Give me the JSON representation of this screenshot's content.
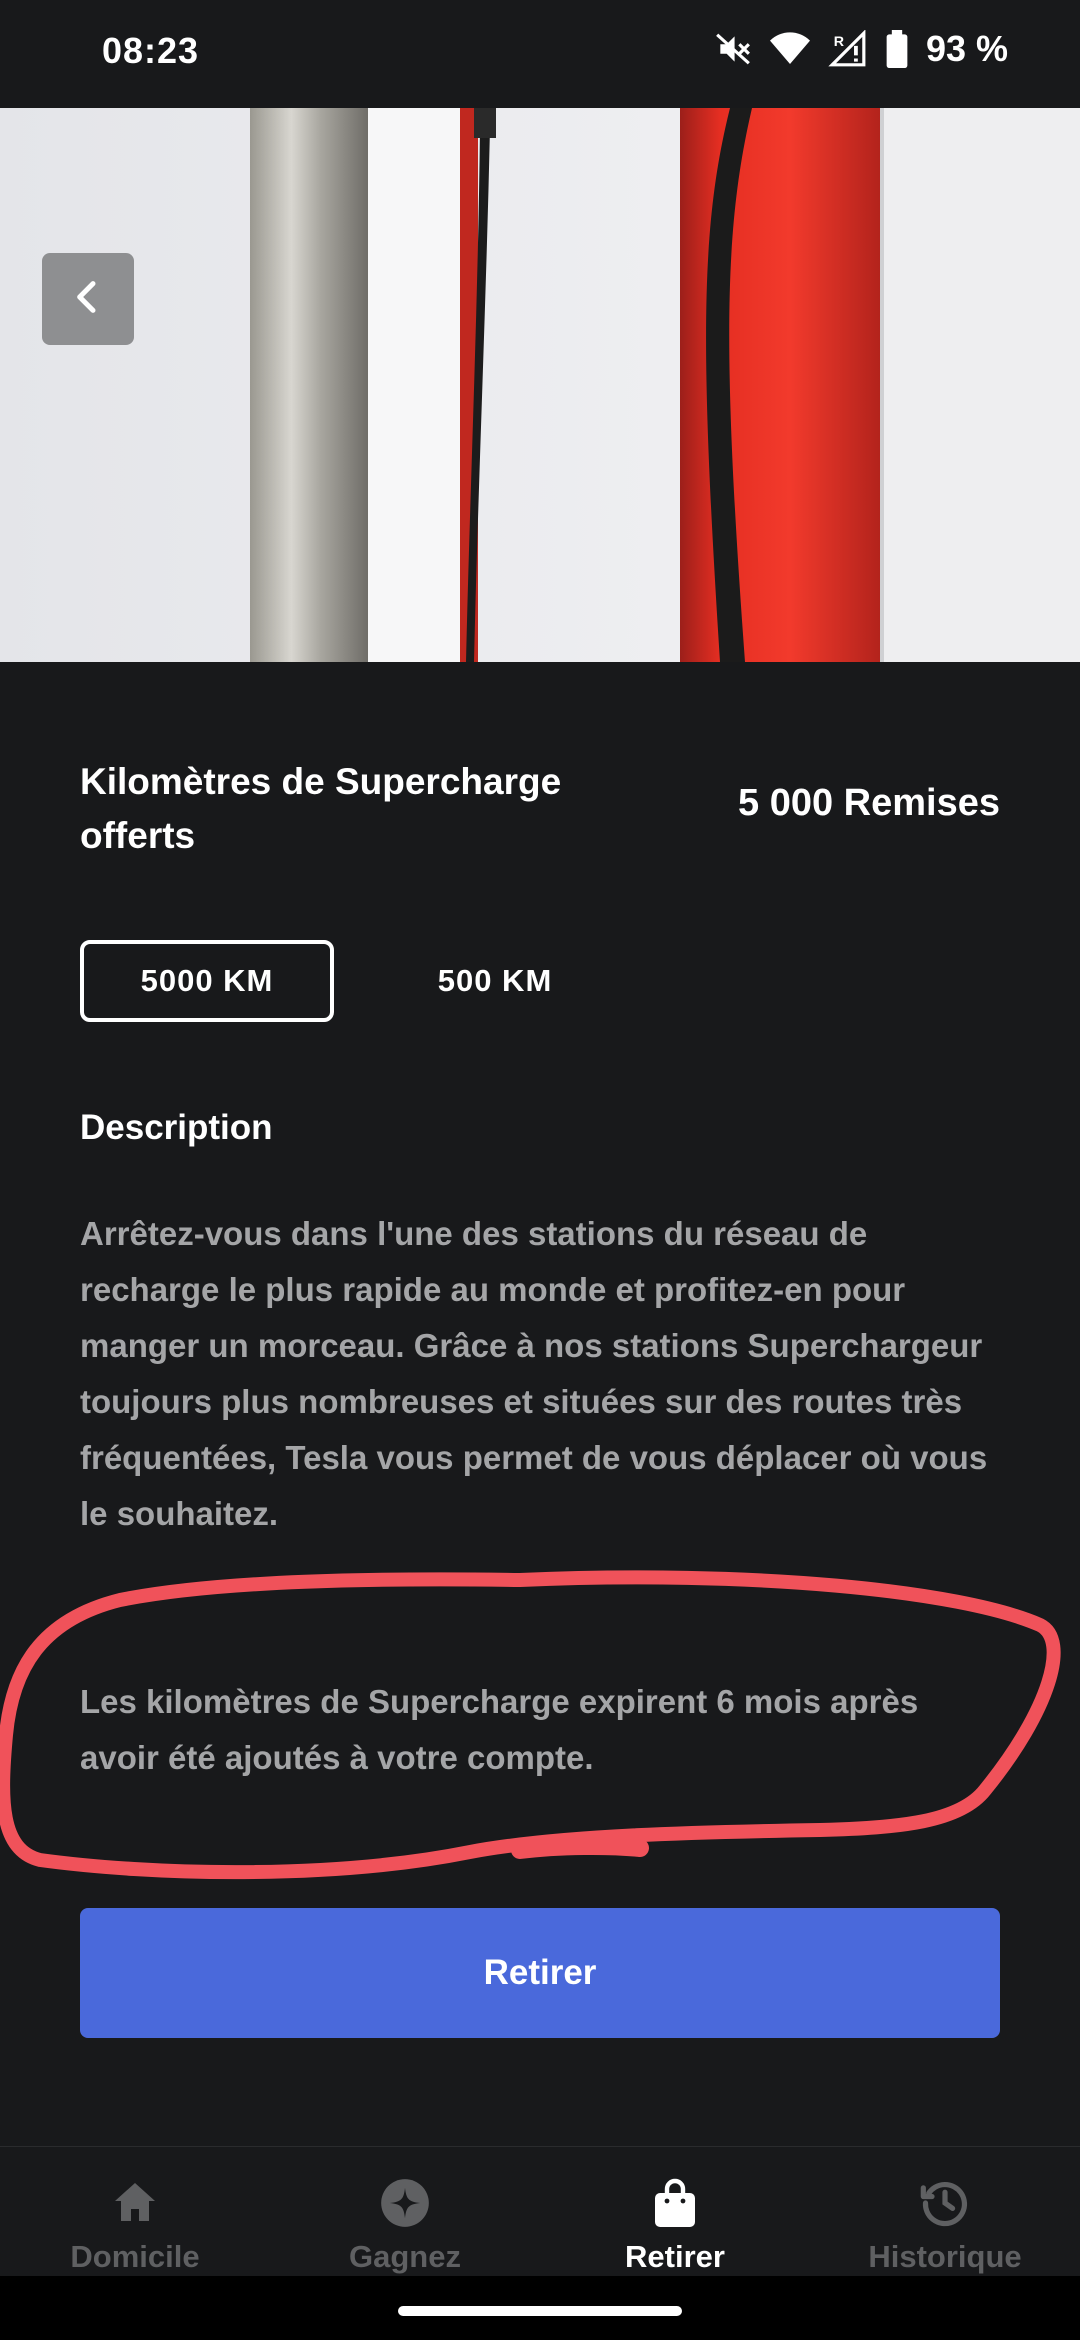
{
  "status_bar": {
    "time": "08:23",
    "battery": "93 %",
    "icons": [
      "mute-icon",
      "wifi-icon",
      "signal-icon",
      "battery-icon"
    ]
  },
  "hero": {
    "back_icon": "chevron-left-icon"
  },
  "product": {
    "title": "Kilomètres de Supercharge offerts",
    "price": "5 000 Remises"
  },
  "options": {
    "selected": "5000 KM",
    "other": "500 KM"
  },
  "description": {
    "heading": "Description",
    "text": "Arrêtez-vous dans l'une des stations du réseau de recharge le plus rapide au monde et profitez-en pour manger un morceau. Grâce à nos stations Superchargeur toujours plus nombreuses et situées sur des routes très fréquentées, Tesla vous permet de vous déplacer où vous le souhaitez.",
    "expiry": "Les kilomètres de Supercharge expirent 6 mois après avoir été ajoutés à votre compte."
  },
  "cta": {
    "label": "Retirer",
    "color": "#4a69db"
  },
  "annotation": {
    "color": "#f0525a"
  },
  "bottom_nav": {
    "items": [
      {
        "label": "Domicile",
        "icon": "home-icon"
      },
      {
        "label": "Gagnez",
        "icon": "sparkle-icon"
      },
      {
        "label": "Retirer",
        "icon": "shopping-bag-icon",
        "active": true
      },
      {
        "label": "Historique",
        "icon": "history-icon"
      }
    ]
  }
}
